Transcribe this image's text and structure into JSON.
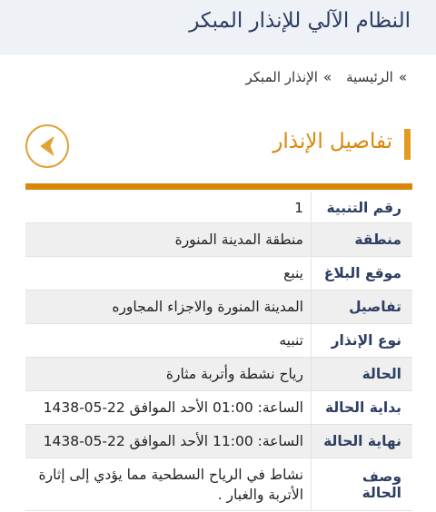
{
  "header": {
    "title": "النظام الآلي للإنذار المبكر"
  },
  "breadcrumb": {
    "home": "الرئيسية",
    "current": "الإنذار المبكر",
    "separator": "»"
  },
  "section": {
    "title": "تفاصيل الإنذار"
  },
  "back_button": {
    "icon": "chevron-left-icon"
  },
  "colors": {
    "accent": "#d9860a",
    "title_blue": "#2d3e63",
    "header_bg": "#eef1f6"
  },
  "details": [
    {
      "label": "رقم التنبية",
      "value": "1"
    },
    {
      "label": "منطقة",
      "value": "منطقة المدينة المنورة"
    },
    {
      "label": "موقع البلاغ",
      "value": "ينبع"
    },
    {
      "label": "تفاصيل",
      "value": "المدينة المنورة والاجزاء المجاوره"
    },
    {
      "label": "نوع الإنذار",
      "value": "تنبيه"
    },
    {
      "label": "الحالة",
      "value": "رياح نشطة وأتربة مثارة"
    },
    {
      "label": "بداية الحالة",
      "value": "الساعة: 01:00 الأحد الموافق 22-05-1438"
    },
    {
      "label": "نهاية الحالة",
      "value": "الساعة: 11:00 الأحد الموافق 22-05-1438"
    },
    {
      "label": "وصف الحالة",
      "value": "نشاط في الرياح السطحية مما يؤدي إلى إثارة الأتربة والغبار ."
    }
  ]
}
